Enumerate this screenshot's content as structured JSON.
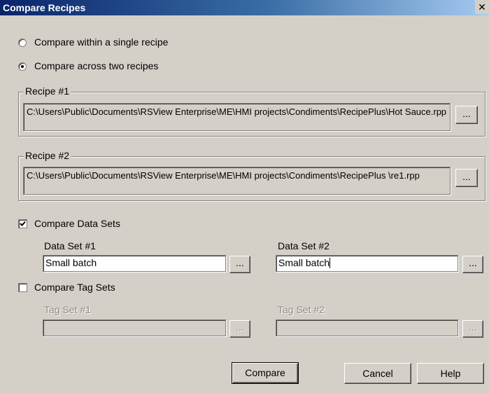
{
  "window": {
    "title": "Compare Recipes",
    "close_glyph": "✕"
  },
  "mode": {
    "single_label": "Compare within a single recipe",
    "across_label": "Compare across two recipes",
    "selected": "across"
  },
  "recipe1": {
    "legend": "Recipe #1",
    "path": "C:\\Users\\Public\\Documents\\RSView Enterprise\\ME\\HMI projects\\Condiments\\RecipePlus\\Hot Sauce.rpp",
    "browse_label": "..."
  },
  "recipe2": {
    "legend": "Recipe #2",
    "path": "C:\\Users\\Public\\Documents\\RSView Enterprise\\ME\\HMI projects\\Condiments\\RecipePlus \\re1.rpp",
    "browse_label": "..."
  },
  "data_sets": {
    "checkbox_label": "Compare Data Sets",
    "checked": true,
    "set1_label": "Data Set #1",
    "set1_value": "Small batch",
    "set2_label": "Data Set #2",
    "set2_value": "Small batch",
    "browse_label": "..."
  },
  "tag_sets": {
    "checkbox_label": "Compare Tag Sets",
    "checked": false,
    "set1_label": "Tag Set #1",
    "set1_value": "",
    "set2_label": "Tag Set #2",
    "set2_value": "",
    "browse_label": "..."
  },
  "buttons": {
    "compare": "Compare",
    "cancel": "Cancel",
    "help": "Help"
  }
}
